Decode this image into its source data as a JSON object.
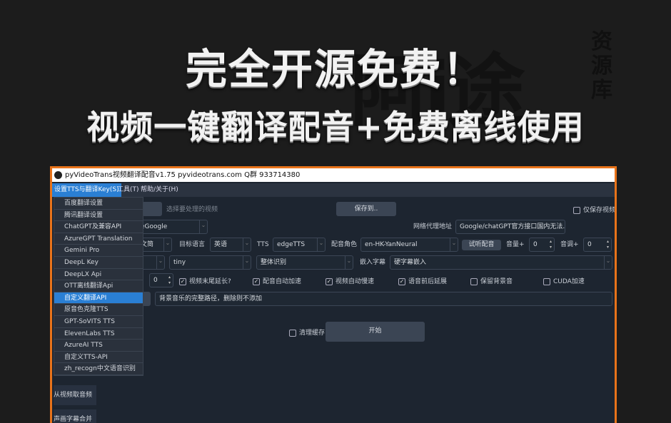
{
  "banner": {
    "line1": "完全开源免费！",
    "line2": "视频一键翻译配音+免费离线使用",
    "watermark": {
      "logo": "阿i途",
      "side": "资源库"
    }
  },
  "window": {
    "title": "pyVideoTrans视频翻译配音v1.75 pyvideotrans.com  Q群 933714380",
    "accent": "#e8731a",
    "menubar": [
      "设置TTS与翻译Key(S)",
      "工具(T)",
      "帮助/关于(H)"
    ],
    "dropdown": {
      "items": [
        "百度翻译设置",
        "腾讯翻译设置",
        "ChatGPT及兼容API",
        "AzureGPT Translation",
        "Gemini Pro",
        "DeepL Key",
        "DeepLX Api",
        "OTT离线翻译Api",
        "自定义翻译API",
        "原音色克隆TTS",
        "GPT-SoVITS TTS",
        "ElevenLabs TTS",
        "AzureAI TTS",
        "自定义TTS-API",
        "zh_recogn中文语音识别"
      ],
      "highlighted": "自定义翻译API",
      "highlight_color": "#2a7fd4"
    },
    "sidebar": [
      "从视频取音频",
      "声画字幕合并"
    ],
    "form": {
      "select_video_hint": "选择要处理的视频",
      "save_to": "保存到..",
      "only_save_video": "仅保存视频",
      "translate_channel": "eGoogle",
      "proxy_label": "网络代理地址",
      "proxy_placeholder": "Google/chatGPT官方接口国内无法...",
      "source_lang": "文简",
      "target_lang_label": "目标语言",
      "target_lang": "英语",
      "tts_label": "TTS",
      "tts": "edgeTTS",
      "voice_role_label": "配音角色",
      "voice_role": "en-HK-YanNeural",
      "listen_button": "试听配音",
      "volume_label": "音量+",
      "volume": "0",
      "pitch_label": "音调+",
      "pitch": "0",
      "model": "tiny",
      "recognition": "整体识别",
      "subtitle_label": "嵌入字幕",
      "subtitle": "硬字幕嵌入",
      "spin_value": "0",
      "checkboxes": [
        {
          "label": "视频末尾延长?",
          "checked": true
        },
        {
          "label": "配音自动加速",
          "checked": true
        },
        {
          "label": "视频自动慢速",
          "checked": true
        },
        {
          "label": "语音前后延展",
          "checked": true
        },
        {
          "label": "保留背景音",
          "checked": false
        },
        {
          "label": "CUDA加速",
          "checked": false
        }
      ],
      "bgm_placeholder": "背景音乐的完整路径，删除则不添加",
      "clear_cache": "清理缓存",
      "clear_cache_checked": false,
      "start": "开始"
    }
  }
}
